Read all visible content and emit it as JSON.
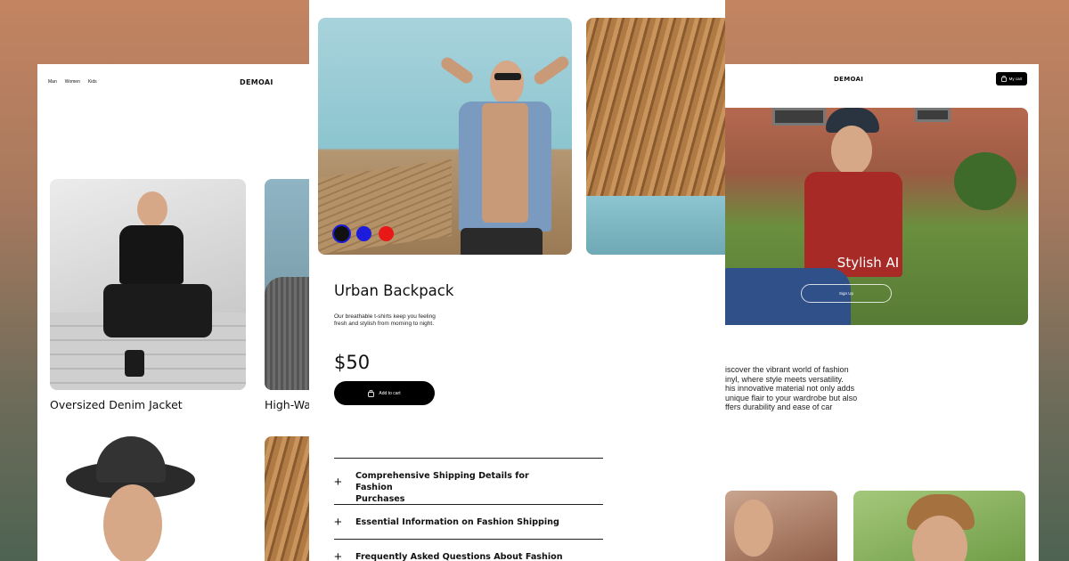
{
  "colors": {
    "swatch_black": "#111111",
    "swatch_blue": "#1c1cdc",
    "swatch_red": "#e81818",
    "button_bg": "#000000"
  },
  "left_page": {
    "nav": [
      "Man",
      "Women",
      "Kids"
    ],
    "brand": "DEMOAI",
    "cards": [
      {
        "title": "Oversized Denim Jacket"
      },
      {
        "title": "High-Wa"
      }
    ]
  },
  "product_page": {
    "swatches": [
      "black",
      "blue",
      "red"
    ],
    "title": "Urban Backpack",
    "description_line1": "Our breathable t-shirts keep you feeling",
    "description_line2": "fresh and stylish from morning to night.",
    "price": "$50",
    "add_to_cart": "Add to cart",
    "icons": {
      "cart": "bag-icon",
      "expand": "plus-icon"
    },
    "faq": [
      {
        "line1": "Comprehensive Shipping Details for Fashion",
        "line2": "Purchases"
      },
      {
        "line1": "Essential Information on Fashion Shipping",
        "line2": ""
      },
      {
        "line1": "Frequently Asked Questions About Fashion Shipping",
        "line2": ""
      }
    ]
  },
  "right_page": {
    "brand": "DEMOAI",
    "cart_button": "My cart",
    "hero_title": "Stylish AI",
    "hero_button": "Sign Up",
    "paragraph": [
      "iscover the vibrant world of fashion",
      "inyl, where style meets versatility.",
      "his innovative material not only adds",
      " unique flair to your wardrobe but also",
      "ffers durability and ease of car"
    ]
  }
}
